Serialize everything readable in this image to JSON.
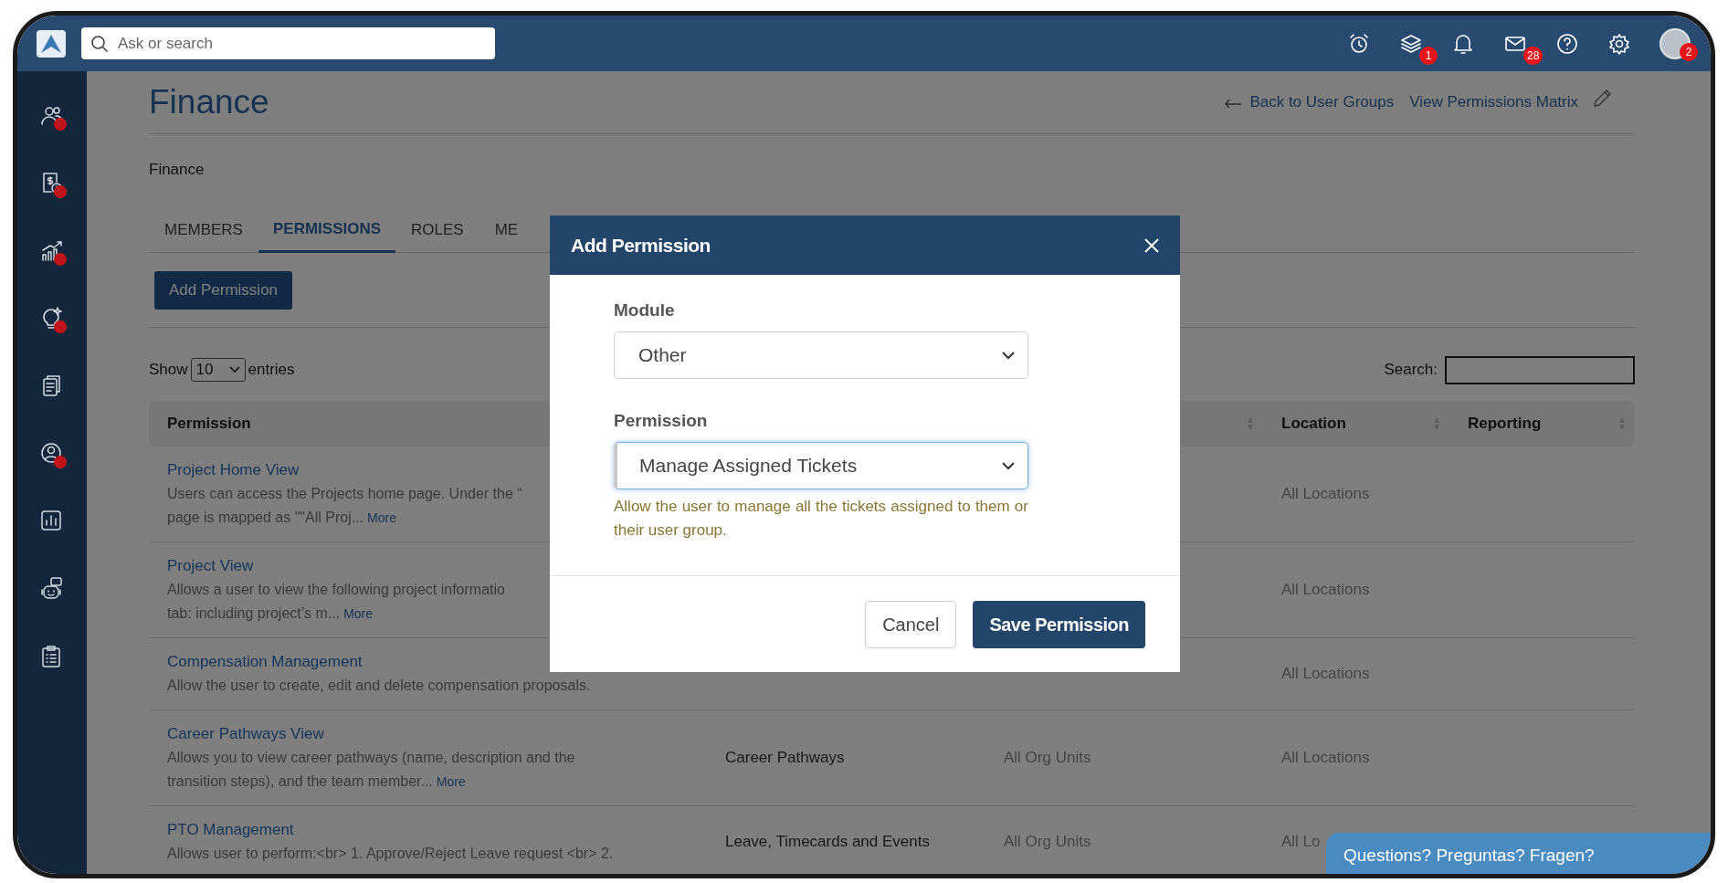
{
  "topbar": {
    "search_placeholder": "Ask or search",
    "icons": [
      {
        "kind": "alarm"
      },
      {
        "kind": "layers",
        "badge": "1"
      },
      {
        "kind": "bell"
      },
      {
        "kind": "mail",
        "badge": "28"
      },
      {
        "kind": "help"
      },
      {
        "kind": "settings"
      },
      {
        "kind": "avatar",
        "badge": "2"
      }
    ]
  },
  "sidebar": {
    "items": [
      {
        "kind": "people",
        "alert": true
      },
      {
        "kind": "payroll",
        "alert": true
      },
      {
        "kind": "growth",
        "alert": true
      },
      {
        "kind": "idea",
        "alert": true
      },
      {
        "kind": "documents",
        "alert": false
      },
      {
        "kind": "profile",
        "alert": true
      },
      {
        "kind": "report",
        "alert": false
      },
      {
        "kind": "bot",
        "alert": false
      },
      {
        "kind": "checklist",
        "alert": false
      }
    ]
  },
  "page": {
    "title": "Finance",
    "links": [
      "Back to User Groups",
      "View Permissions Matrix"
    ],
    "subtitle": "Finance"
  },
  "tabs": [
    {
      "label": "MEMBERS",
      "selected": false
    },
    {
      "label": "PERMISSIONS",
      "selected": true
    },
    {
      "label": "ROLES",
      "selected": false
    },
    {
      "label": "ME",
      "selected": false
    }
  ],
  "add_button": "Add Permission",
  "table_controls": {
    "show_label": "Show",
    "page_size": "10",
    "entries_label": "entries",
    "search_label": "Search:"
  },
  "table": {
    "columns": [
      {
        "label": "Permission"
      },
      {
        "sortable": true
      },
      {
        "label": "Location",
        "sortable": true
      },
      {
        "label": "Reporting",
        "sortable": true
      }
    ],
    "rows": [
      {
        "title": "Project Home View",
        "description_lines": [
          {
            "text": "Users can access the Projects home page. Under the “"
          },
          {
            "text": "page is mapped as \"\"All Proj...",
            "link": "More"
          }
        ],
        "location": "All Locations"
      },
      {
        "title": "Project View",
        "description_lines": [
          {
            "text": "Allows a user to view the following project informatio"
          },
          {
            "text": "tab: including project’s m...",
            "link": "More"
          }
        ],
        "location": "All Locations"
      },
      {
        "title": "Compensation Management",
        "description_lines": [
          {
            "text": "Allow the user to create, edit and delete compensation proposals."
          }
        ],
        "location": "All Locations"
      },
      {
        "title": "Career Pathways View",
        "description_lines": [
          {
            "text": "Allows you to view career pathways (name, description and the"
          },
          {
            "text": "transition steps), and the team member...",
            "link": "More"
          }
        ],
        "module": "Career Pathways",
        "org_units": "All Org Units",
        "location": "All Locations"
      },
      {
        "title": "PTO Management",
        "description_lines": [
          {
            "text": "Allows user to perform:<br> 1. Approve/Reject Leave request <br> 2."
          }
        ],
        "module": "Leave, Timecards and Events",
        "org_units": "All Org Units",
        "location": "All Lo"
      }
    ]
  },
  "modal": {
    "title": "Add Permission",
    "fields": [
      {
        "label": "Module",
        "value": "Other",
        "focused": false
      },
      {
        "label": "Permission",
        "value": "Manage Assigned Tickets",
        "focused": true
      }
    ],
    "help": "Allow the user to manage all the tickets assigned to them or their user group.",
    "buttons": [
      {
        "label": "Cancel",
        "kind": "secondary"
      },
      {
        "label": "Save Permission",
        "kind": "primary"
      }
    ]
  },
  "chat": {
    "label": "Questions? Preguntas? Fragen?"
  }
}
